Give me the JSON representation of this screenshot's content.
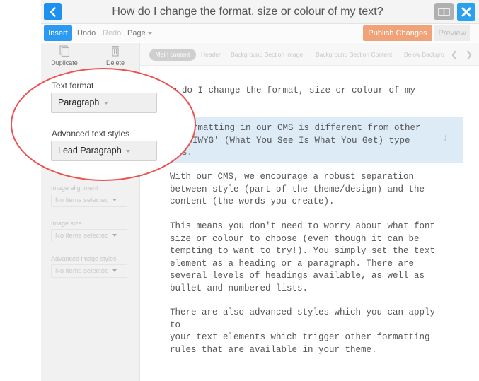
{
  "window": {
    "title": "How do I change the format, size or colour of my text?"
  },
  "toolbar": {
    "insert": "Insert",
    "undo": "Undo",
    "redo": "Redo",
    "page": "Page",
    "publish": "Publish Changes",
    "preview": "Preview"
  },
  "actions": {
    "duplicate": "Duplicate",
    "delete": "Delete"
  },
  "text_format": {
    "label": "Text format",
    "value": "Paragraph"
  },
  "advanced_text_styles": {
    "label": "Advanced text styles",
    "value": "Lead Paragraph"
  },
  "image_alignment": {
    "label": "Image alignment",
    "value": "No items selected"
  },
  "image_size": {
    "label": "Image size",
    "value": "No items selected"
  },
  "advanced_image_styles": {
    "label": "Advanced image styles",
    "value": "No items selected"
  },
  "tabs": [
    "Main content",
    "Header",
    "Background Section Image",
    "Background Section Content",
    "Below Backgro"
  ],
  "content": {
    "heading_line1": "w do I change the format, size or colour of my",
    "heading_line2": "t?",
    "highlight_line1": "t formatting in our CMS is different from other",
    "highlight_line2": "'WYSIWYG' (What You See Is What You Get) type",
    "highlight_line3": "ems.",
    "p1_line1": "With our CMS, we encourage a robust separation",
    "p1_line2": "between style (part of the theme/design) and the",
    "p1_line3": "content (the words you create).",
    "p2_line1": "This means you don't need to worry about what font",
    "p2_line2": "size or colour to choose (even though it can be",
    "p2_line3": "tempting to want to try!). You simply set the text",
    "p2_line4": "element as a heading or a paragraph. There are",
    "p2_line5": "several levels of headings available, as well as",
    "p2_line6": "bullet and numbered lists.",
    "p3_line1": "There are also advanced styles which you can apply to",
    "p3_line2": "your text elements which trigger other formatting",
    "p3_line3": "rules that are available in your theme."
  },
  "icons": {
    "back": "chevron-left-icon",
    "layout": "layout-toggle-icon",
    "close": "close-icon",
    "duplicate": "duplicate-icon",
    "delete": "trash-icon",
    "move": "move-vertical-icon"
  },
  "colors": {
    "accent_blue": "#2b9af0",
    "publish_orange": "#f0a378",
    "callout_red": "#ec5050",
    "highlight_blue": "#ddebf7"
  }
}
